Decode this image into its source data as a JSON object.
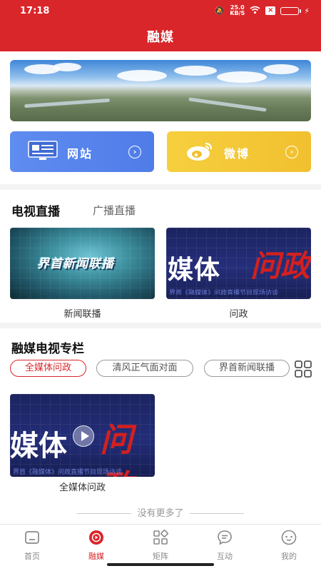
{
  "status_bar": {
    "time": "17:18",
    "speed_value": "25.0",
    "speed_unit": "KB/S"
  },
  "header": {
    "title": "融媒"
  },
  "quick_links": [
    {
      "label": "网站",
      "icon": "monitor-icon"
    },
    {
      "label": "微博",
      "icon": "weibo-icon"
    }
  ],
  "live": {
    "tabs": [
      "电视直播",
      "广播直播"
    ],
    "channels": [
      {
        "caption": "新闻联播",
        "overlay_text": "界首新闻联播"
      },
      {
        "caption": "问政",
        "overlay_text_main": "媒体",
        "overlay_text_red": "问政",
        "overlay_sub": "界首《融媒体》问政直播节目现场访谈"
      }
    ]
  },
  "column": {
    "title": "融媒电视专栏",
    "chips": [
      "全媒体问政",
      "清风正气面对面",
      "界首新闻联播"
    ],
    "video": {
      "caption": "全媒体问政",
      "overlay_text_main": "媒体",
      "overlay_text_red": "问政",
      "overlay_sub": "界首《融媒体》问政直播节目现场访谈"
    },
    "end_text": "没有更多了"
  },
  "tabbar": [
    {
      "label": "首页",
      "icon": "home-icon"
    },
    {
      "label": "融媒",
      "icon": "play-circle-icon"
    },
    {
      "label": "矩阵",
      "icon": "matrix-icon"
    },
    {
      "label": "互动",
      "icon": "chat-icon"
    },
    {
      "label": "我的",
      "icon": "profile-icon"
    }
  ],
  "colors": {
    "brand_red": "#d9262a",
    "website_blue": "#5f8cf0",
    "weibo_yellow": "#f6cf3f"
  }
}
